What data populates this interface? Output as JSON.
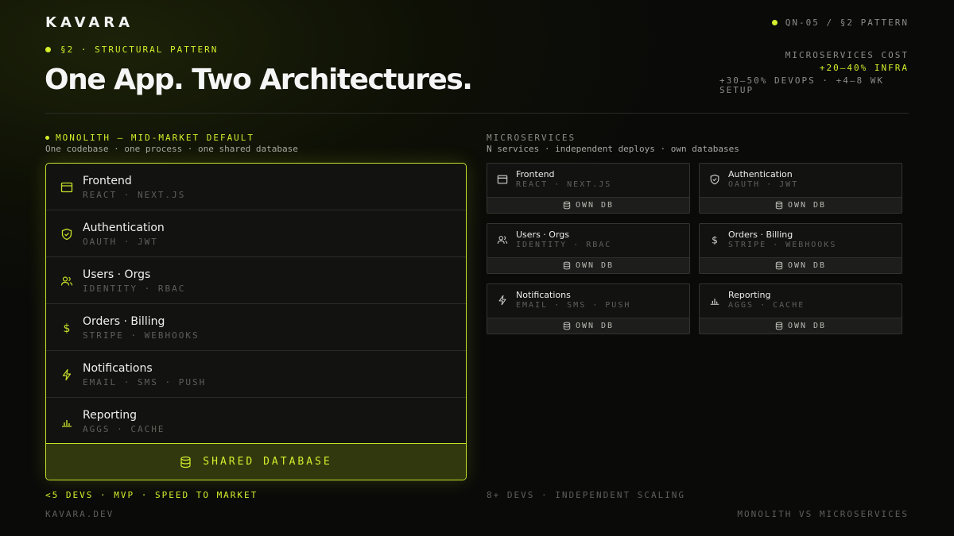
{
  "brand": "KAVARA",
  "top_tag": "QN-05 / §2 PATTERN",
  "section_label": "§2 · STRUCTURAL PATTERN",
  "headline": "One App. Two Architectures.",
  "cost": {
    "label": "MICROSERVICES COST",
    "infra": "+20–40% INFRA",
    "devops": "+30–50% DEVOPS · +4–8 WK SETUP"
  },
  "monolith": {
    "title": "MONOLITH — MID-MARKET DEFAULT",
    "subtitle": "One codebase · one process · one shared database",
    "modules": [
      {
        "name": "Frontend",
        "tech": "REACT · NEXT.JS",
        "icon": "browser-window-icon"
      },
      {
        "name": "Authentication",
        "tech": "OAUTH · JWT",
        "icon": "shield-check-icon"
      },
      {
        "name": "Users · Orgs",
        "tech": "IDENTITY · RBAC",
        "icon": "users-icon"
      },
      {
        "name": "Orders · Billing",
        "tech": "STRIPE · WEBHOOKS",
        "icon": "dollar-icon"
      },
      {
        "name": "Notifications",
        "tech": "EMAIL · SMS · PUSH",
        "icon": "lightning-icon"
      },
      {
        "name": "Reporting",
        "tech": "AGGS · CACHE",
        "icon": "bar-chart-icon"
      }
    ],
    "shared_db": "SHARED DATABASE",
    "footer": "<5 DEVS · MVP · SPEED TO MARKET"
  },
  "microservices": {
    "title": "MICROSERVICES",
    "subtitle": "N services · independent deploys · own databases",
    "services": [
      {
        "name": "Frontend",
        "tech": "REACT · NEXT.JS",
        "icon": "browser-window-icon",
        "db": "OWN DB"
      },
      {
        "name": "Authentication",
        "tech": "OAUTH · JWT",
        "icon": "shield-check-icon",
        "db": "OWN DB"
      },
      {
        "name": "Users · Orgs",
        "tech": "IDENTITY · RBAC",
        "icon": "users-icon",
        "db": "OWN DB"
      },
      {
        "name": "Orders · Billing",
        "tech": "STRIPE · WEBHOOKS",
        "icon": "dollar-icon",
        "db": "OWN DB"
      },
      {
        "name": "Notifications",
        "tech": "EMAIL · SMS · PUSH",
        "icon": "lightning-icon",
        "db": "OWN DB"
      },
      {
        "name": "Reporting",
        "tech": "AGGS · CACHE",
        "icon": "bar-chart-icon",
        "db": "OWN DB"
      }
    ],
    "footer": "8+ DEVS · INDEPENDENT SCALING"
  },
  "site": "KAVARA.DEV",
  "page_topic": "MONOLITH VS MICROSERVICES",
  "colors": {
    "accent": "#d4ee2c",
    "background": "#0b0b0a",
    "panel": "#121210"
  }
}
